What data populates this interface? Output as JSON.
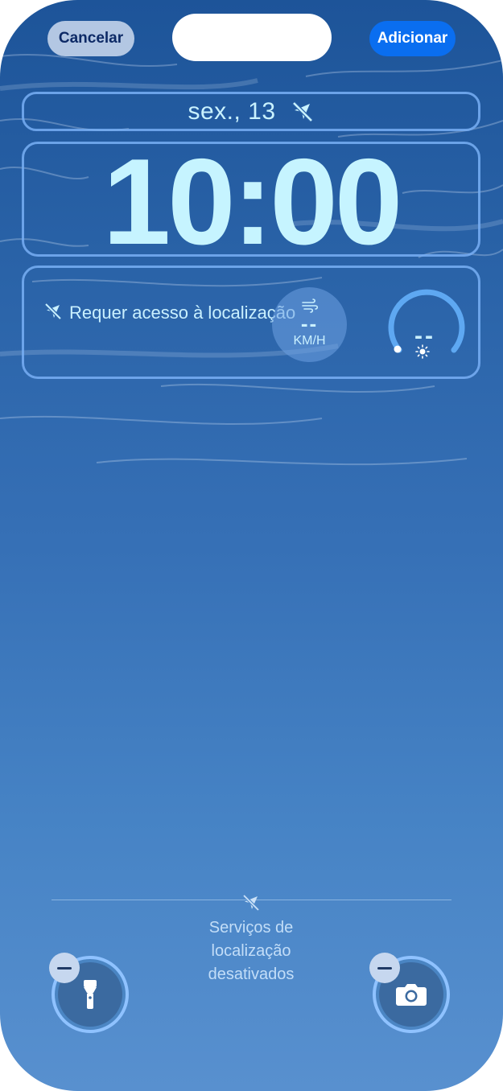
{
  "header": {
    "cancel_label": "Cancelar",
    "add_label": "Adicionar"
  },
  "lock_screen": {
    "date": "sex., 13",
    "time": "10:00"
  },
  "widgets": {
    "location_message": "Requer acesso à localização",
    "wind_value": "--",
    "wind_unit": "KM/H",
    "uv_value": "--"
  },
  "footer": {
    "location_status": "Serviços de\nlocalização\ndesativados"
  },
  "quick_actions": {
    "left_icon": "flashlight-icon",
    "right_icon": "camera-icon"
  },
  "colors": {
    "accent": "#0a6ef0",
    "text_light": "#c6f4ff",
    "frame": "#78aff5"
  }
}
